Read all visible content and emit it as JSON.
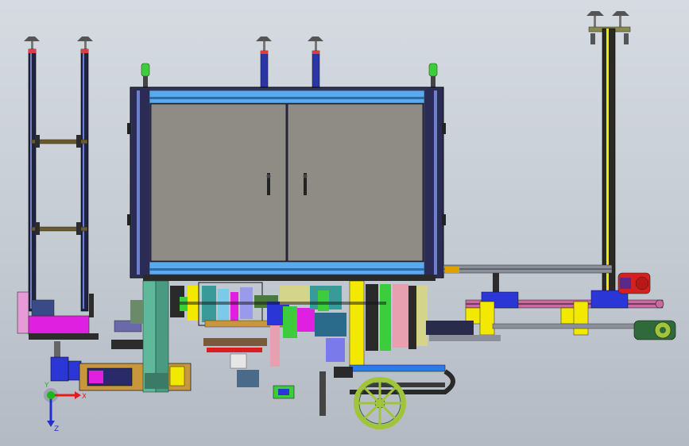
{
  "view": {
    "background_top": "#d6dbe2",
    "background_bottom": "#b4bac3"
  },
  "triad": {
    "x_label": "X",
    "y_label": "Y",
    "z_label": "Z",
    "x_color": "#e01e1e",
    "y_color": "#18b818",
    "z_color": "#2030d0"
  },
  "palette": {
    "cabinet_frame": "#33355a",
    "cabinet_panel": "#8f8c86",
    "cabinet_rail": "#5aa9ee",
    "column": "#1f2340",
    "magenta": "#e020e0",
    "yellow": "#f2e800",
    "blue": "#2a36d6",
    "green_wheel": "#a2c43a",
    "red": "#d62020",
    "lime_cap": "#3ccc3c",
    "orange_plate": "#c8963c",
    "pink_rail": "#c86aa0",
    "teal": "#5fb89a"
  }
}
